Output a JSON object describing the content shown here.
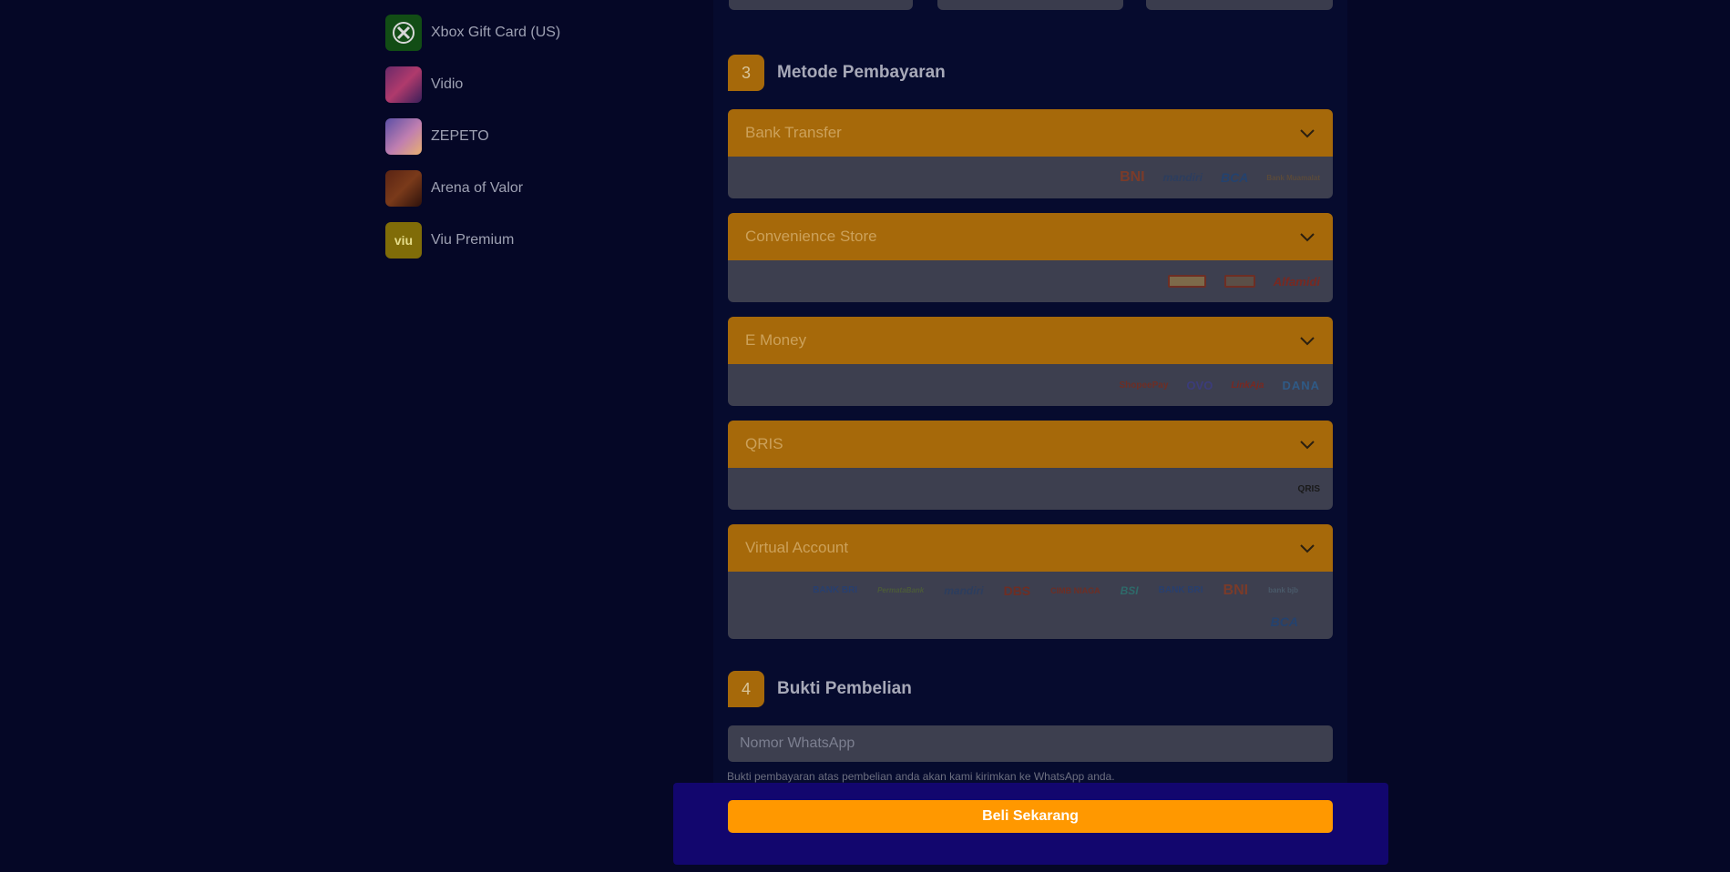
{
  "sidebar": {
    "games": [
      {
        "name": "Xbox Gift Card (US)",
        "thumb": "xbox-logo-icon"
      },
      {
        "name": "Vidio",
        "thumb": "vidio-thumbnail"
      },
      {
        "name": "ZEPETO",
        "thumb": "zepeto-thumbnail"
      },
      {
        "name": "Arena of Valor",
        "thumb": "aov-thumbnail"
      },
      {
        "name": "Viu Premium",
        "thumb": "viu-logo",
        "thumb_text": "viu"
      }
    ]
  },
  "payment_section": {
    "step": "3",
    "title": "Metode Pembayaran",
    "groups": [
      {
        "label": "Bank Transfer",
        "logos": [
          "BNI",
          "mandiri",
          "BCA",
          "Bank Muamalat"
        ]
      },
      {
        "label": "Convenience Store",
        "logos": [
          "Indomaret",
          "Alfamart",
          "Alfamidi"
        ]
      },
      {
        "label": "E Money",
        "logos": [
          "ShopeePay",
          "OVO",
          "LinkAja",
          "DANA"
        ]
      },
      {
        "label": "QRIS",
        "logos": [
          "QRIS"
        ]
      },
      {
        "label": "Virtual Account",
        "logos": [
          "BANK BRI",
          "PermataBank",
          "mandiri",
          "DBS",
          "CIMB NIAGA",
          "BSI",
          "BANK BRI",
          "BNI",
          "bank bjb",
          "BCA"
        ]
      }
    ]
  },
  "proof_section": {
    "step": "4",
    "title": "Bukti Pembelian",
    "whatsapp_placeholder": "Nomor WhatsApp",
    "note": "Bukti pembayaran atas pembelian anda akan kami kirimkan ke WhatsApp anda."
  },
  "buy_button": {
    "label": "Beli Sekarang"
  },
  "colors": {
    "background": "#050726",
    "accent": "#ff9800",
    "accent_dimmed": "#a6690a",
    "bottom_bar": "#12066e"
  }
}
